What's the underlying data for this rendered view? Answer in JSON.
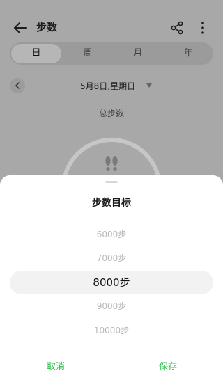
{
  "header": {
    "title": "步数"
  },
  "tabs": [
    {
      "label": "日",
      "active": true
    },
    {
      "label": "周",
      "active": false
    },
    {
      "label": "月",
      "active": false
    },
    {
      "label": "年",
      "active": false
    }
  ],
  "date": {
    "text": "5月8日,星期日"
  },
  "summary": {
    "label": "总步数"
  },
  "sheet": {
    "title": "步数目标",
    "options": [
      "6000步",
      "7000步",
      "8000步",
      "9000步",
      "10000步"
    ],
    "selected": "8000步",
    "cancel_label": "取消",
    "save_label": "保存"
  },
  "colors": {
    "accent": "#2fbf4f"
  },
  "icons": [
    "back-arrow-icon",
    "share-icon",
    "more-vertical-icon",
    "chevron-left-icon",
    "caret-down-icon",
    "footprints-icon"
  ]
}
